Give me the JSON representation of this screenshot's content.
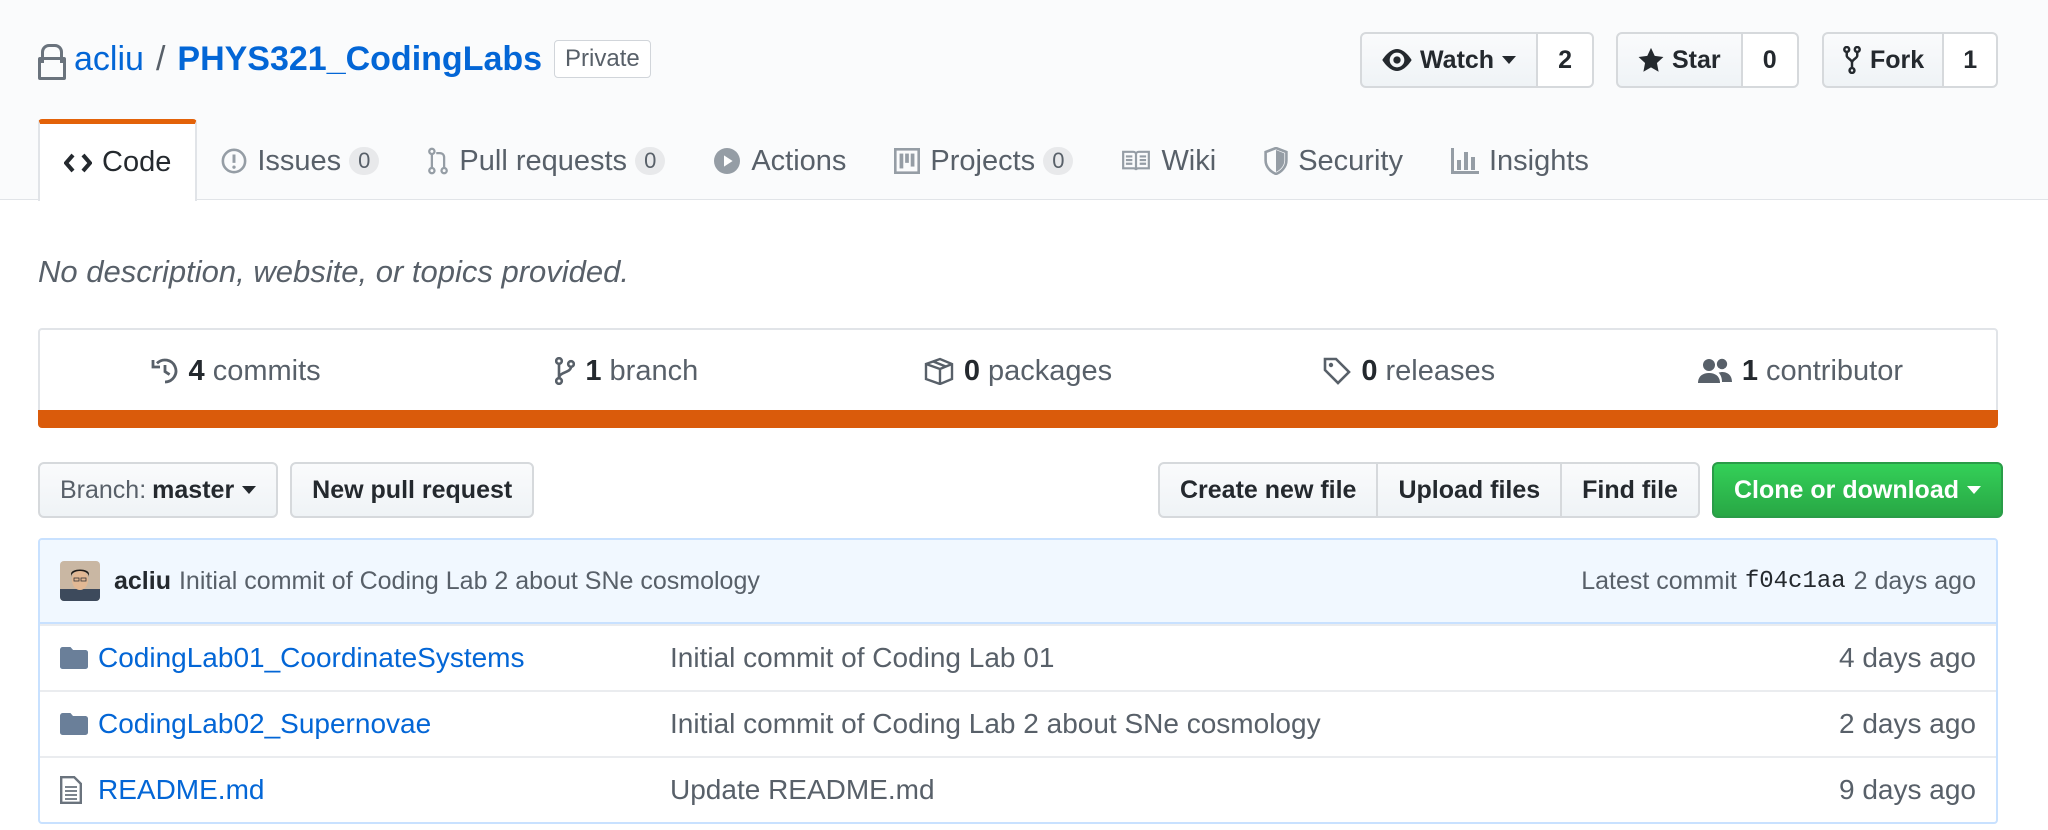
{
  "repo": {
    "owner": "acliu",
    "separator": "/",
    "name": "PHYS321_CodingLabs",
    "visibility": "Private"
  },
  "social": {
    "watch": {
      "label": "Watch",
      "count": "2"
    },
    "star": {
      "label": "Star",
      "count": "0"
    },
    "fork": {
      "label": "Fork",
      "count": "1"
    }
  },
  "tabs": [
    {
      "label": "Code",
      "icon": "code-icon",
      "selected": true
    },
    {
      "label": "Issues",
      "icon": "issue-icon",
      "count": "0"
    },
    {
      "label": "Pull requests",
      "icon": "pull-request-icon",
      "count": "0"
    },
    {
      "label": "Actions",
      "icon": "play-icon"
    },
    {
      "label": "Projects",
      "icon": "project-icon",
      "count": "0"
    },
    {
      "label": "Wiki",
      "icon": "book-icon"
    },
    {
      "label": "Security",
      "icon": "shield-icon"
    },
    {
      "label": "Insights",
      "icon": "graph-icon"
    }
  ],
  "description": "No description, website, or topics provided.",
  "summary": [
    {
      "num": "4",
      "label": "commits",
      "icon": "history-icon"
    },
    {
      "num": "1",
      "label": "branch",
      "icon": "branch-icon"
    },
    {
      "num": "0",
      "label": "packages",
      "icon": "package-icon"
    },
    {
      "num": "0",
      "label": "releases",
      "icon": "tag-icon"
    },
    {
      "num": "1",
      "label": "contributor",
      "icon": "people-icon"
    }
  ],
  "language_bar_color": "#da5b0b",
  "accent_color": "#e36209",
  "file_nav": {
    "branch_prefix": "Branch:",
    "branch_name": "master",
    "new_pull_request": "New pull request",
    "create_new_file": "Create new file",
    "upload_files": "Upload files",
    "find_file": "Find file",
    "clone_or_download": "Clone or download"
  },
  "latest_commit": {
    "author": "acliu",
    "message": "Initial commit of Coding Lab 2 about SNe cosmology",
    "prefix": "Latest commit",
    "sha": "f04c1aa",
    "age": "2 days ago"
  },
  "files": [
    {
      "name": "CodingLab01_CoordinateSystems",
      "type": "folder",
      "message": "Initial commit of Coding Lab 01",
      "age": "4 days ago"
    },
    {
      "name": "CodingLab02_Supernovae",
      "type": "folder",
      "message": "Initial commit of Coding Lab 2 about SNe cosmology",
      "age": "2 days ago"
    },
    {
      "name": "README.md",
      "type": "file",
      "message": "Update README.md",
      "age": "9 days ago"
    }
  ]
}
